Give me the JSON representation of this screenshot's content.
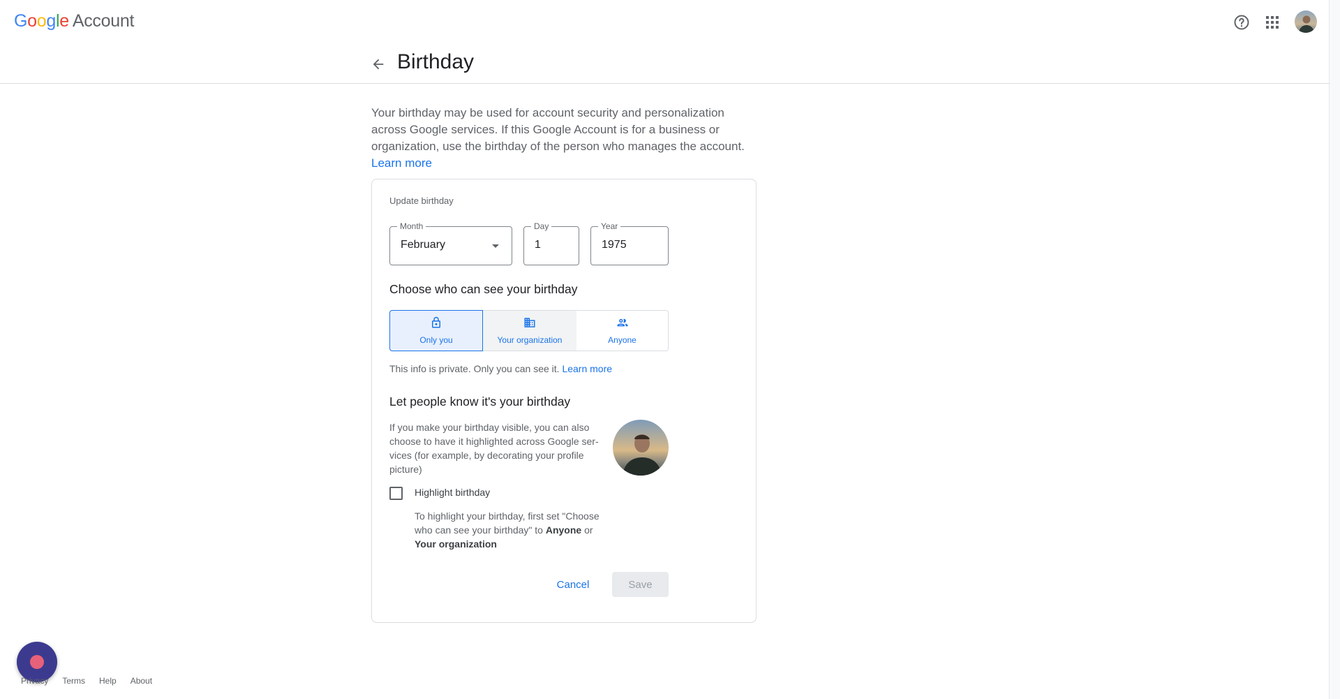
{
  "header": {
    "logo_letters": [
      "G",
      "o",
      "o",
      "g",
      "l",
      "e"
    ],
    "logo_suffix": "Account",
    "help_icon": "help-circle-icon",
    "apps_icon": "apps-grid-icon"
  },
  "page": {
    "title": "Birthday",
    "back_icon": "arrow-back-icon",
    "intro_text": "Your birthday may be used for account security and personalization across Google services. If this Google Account is for a business or organization, use the birthday of the person who manages the account.",
    "intro_link": "Learn more"
  },
  "card": {
    "update_label": "Update birthday",
    "month": {
      "label": "Month",
      "value": "February"
    },
    "day": {
      "label": "Day",
      "value": "1"
    },
    "year": {
      "label": "Year",
      "value": "1975"
    },
    "visibility_heading": "Choose who can see your birthday",
    "visibility_options": [
      {
        "label": "Only you",
        "icon": "lock-icon",
        "selected": true
      },
      {
        "label": "Your organization",
        "icon": "building-icon",
        "selected": false
      },
      {
        "label": "Anyone",
        "icon": "people-icon",
        "selected": false
      }
    ],
    "privacy_note": "This info is private. Only you can see it.",
    "privacy_link": "Learn more",
    "highlight_heading": "Let people know it's your birthday",
    "highlight_desc": "If you make your birthday visible, you can also choose to have it highlighted across Google ser-vices (for example, by decorating your profile picture)",
    "highlight_checkbox_label": "Highlight birthday",
    "highlight_checked": false,
    "highlight_hint_1": "To highlight your birthday, first set \"Choose who can see your birthday\" to",
    "highlight_hint_anyone": "Anyone",
    "highlight_hint_or": "or",
    "highlight_hint_org": "Your organization",
    "cancel_label": "Cancel",
    "save_label": "Save"
  },
  "footer": {
    "links": [
      "Privacy",
      "Terms",
      "Help",
      "About"
    ]
  },
  "colors": {
    "accent": "#1a73e8",
    "selected_bg": "#e8f0fe",
    "border": "#dadce0"
  }
}
